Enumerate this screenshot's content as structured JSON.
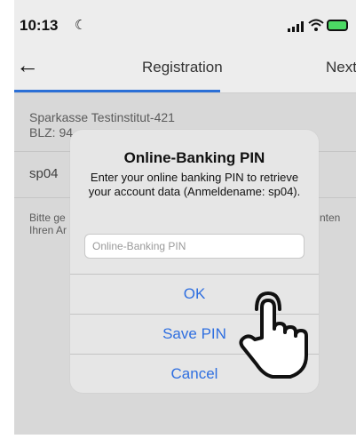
{
  "status_bar": {
    "time": "10:13"
  },
  "nav": {
    "back_icon": "arrow-left-icon",
    "title": "Registration",
    "next_label": "Next"
  },
  "content": {
    "bank_name": "Sparkasse Testinstitut-421",
    "blz": "BLZ: 94",
    "login_name": "sp04",
    "info_line1": "Bitte ge",
    "info_line2": "Ihren Ar",
    "info_right": "nten"
  },
  "dialog": {
    "title": "Online-Banking PIN",
    "message": "Enter your online banking PIN to retrieve your account data (Anmeldename: sp04).",
    "input_placeholder": "Online-Banking PIN",
    "input_value": "",
    "ok_label": "OK",
    "save_label": "Save PIN",
    "cancel_label": "Cancel"
  },
  "colors": {
    "accent": "#2f6fe0",
    "nav_underline": "#2b6fd6",
    "battery": "#4cd964"
  },
  "icons": [
    "moon-icon",
    "signal-icon",
    "wifi-icon",
    "battery-icon",
    "hand-pointer-icon"
  ]
}
